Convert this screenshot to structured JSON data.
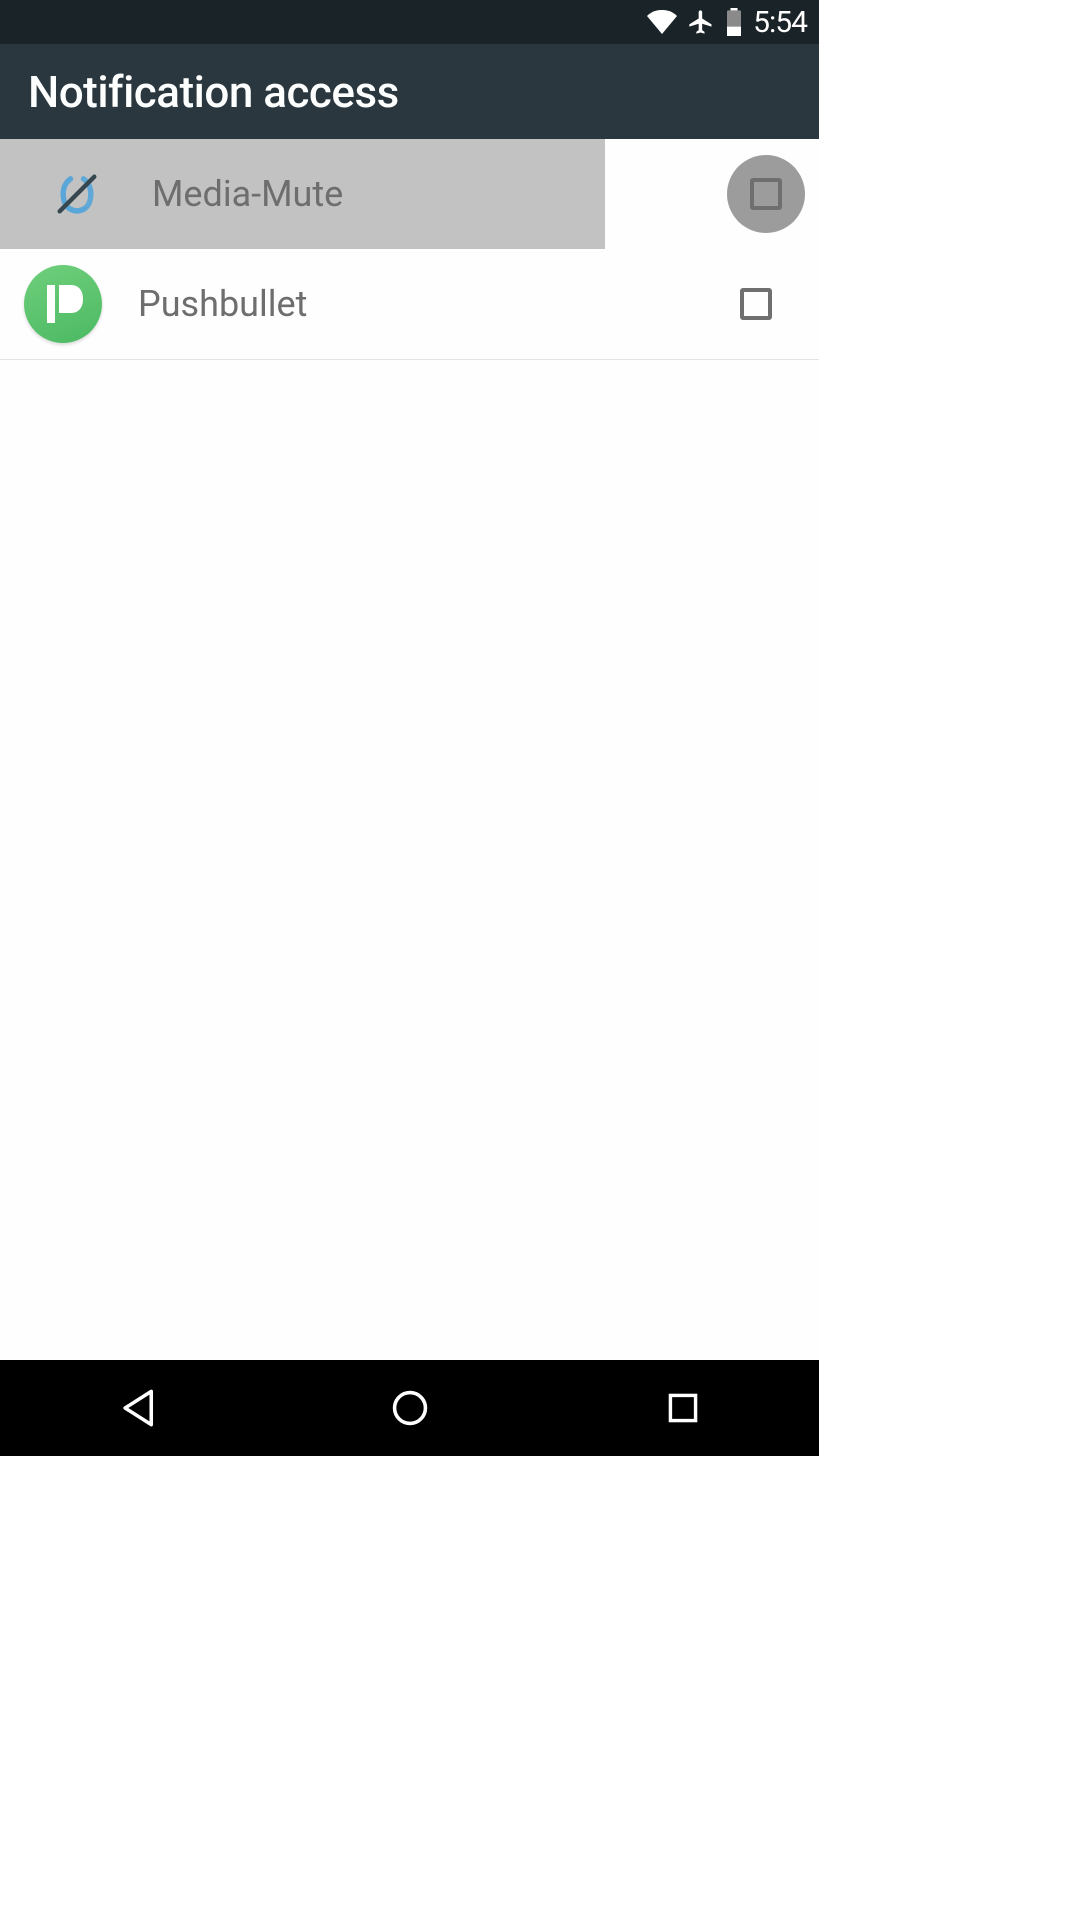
{
  "status": {
    "time": "5:54"
  },
  "header": {
    "title": "Notification access"
  },
  "apps": [
    {
      "label": "Media-Mute",
      "icon": "mute-icon",
      "checked": false,
      "pressed": true
    },
    {
      "label": "Pushbullet",
      "icon": "pushbullet-icon",
      "checked": false,
      "pressed": false
    }
  ]
}
